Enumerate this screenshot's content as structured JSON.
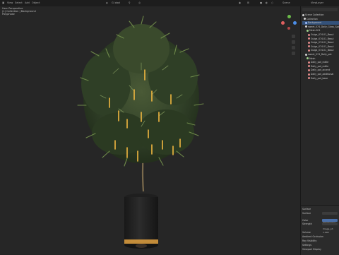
{
  "topbar": {
    "menu_items": [
      "View",
      "Select",
      "Add",
      "Object"
    ],
    "mode_label": "Gl",
    "transform_label": "Gl obal",
    "scene_label": "Scene",
    "view_layer_label": "ViewLayer"
  },
  "viewport_overlay": {
    "lines": [
      "User Perspective",
      "(1) Collection | Background",
      "Polyphase"
    ]
  },
  "outliner": {
    "title": "Scene Collection",
    "rows": [
      {
        "label": "Scene Collection",
        "indent": 0,
        "color": "#d0d0d0",
        "selected": false
      },
      {
        "label": "Collection",
        "indent": 1,
        "color": "#d0d0d0",
        "selected": false
      },
      {
        "label": "Background",
        "indent": 2,
        "color": "#9fbfff",
        "selected": true
      },
      {
        "label": "sweet_074_Daily_Gloss_Spiral",
        "indent": 2,
        "color": "#d0d0d0",
        "selected": false
      },
      {
        "label": "Mesh.001",
        "indent": 3,
        "color": "#9fd38a",
        "selected": false
      },
      {
        "label": "Gulga_074.01_Basul",
        "indent": 4,
        "color": "#e08888",
        "selected": false
      },
      {
        "label": "Gulga_074.01_Basul",
        "indent": 4,
        "color": "#e08888",
        "selected": false
      },
      {
        "label": "Gulga_074.01_Basul",
        "indent": 4,
        "color": "#e08888",
        "selected": false
      },
      {
        "label": "Gulga_074.01_Basul",
        "indent": 4,
        "color": "#e08888",
        "selected": false
      },
      {
        "label": "Gulga_074.01_Basul",
        "indent": 4,
        "color": "#e08888",
        "selected": false
      },
      {
        "label": "sweet_074_Daily_pot",
        "indent": 2,
        "color": "#d0d0d0",
        "selected": false
      },
      {
        "label": "Mesh",
        "indent": 3,
        "color": "#9fd38a",
        "selected": false
      },
      {
        "label": "Daily_pot_rattle",
        "indent": 4,
        "color": "#e08888",
        "selected": false
      },
      {
        "label": "Daily_pot_rattle",
        "indent": 4,
        "color": "#e08888",
        "selected": false
      },
      {
        "label": "Daily_pot_accent",
        "indent": 4,
        "color": "#e08888",
        "selected": false
      },
      {
        "label": "Daily_pot_additional",
        "indent": 4,
        "color": "#e08888",
        "selected": false
      },
      {
        "label": "Daily_pot_base",
        "indent": 4,
        "color": "#e08888",
        "selected": false
      }
    ]
  },
  "properties": {
    "rows": [
      {
        "label": "Surface"
      },
      {
        "label": "Surface"
      },
      {
        "label": "Color"
      },
      {
        "label": "Strength"
      },
      {
        "label": ""
      },
      {
        "label": "Volume"
      },
      {
        "label": "Ambient Occlusion"
      },
      {
        "label": "Ray Visibility"
      },
      {
        "label": "Settings"
      },
      {
        "label": "Viewport Display"
      }
    ],
    "surface_value": "Background",
    "color_value": "Image_ph",
    "strength_value": "1.000"
  },
  "colors": {
    "accent_red": "#e06060",
    "accent_green": "#6bbb4a",
    "accent_blue": "#4c8ee8",
    "selection": "#34527a",
    "glow": "#f2b840"
  }
}
